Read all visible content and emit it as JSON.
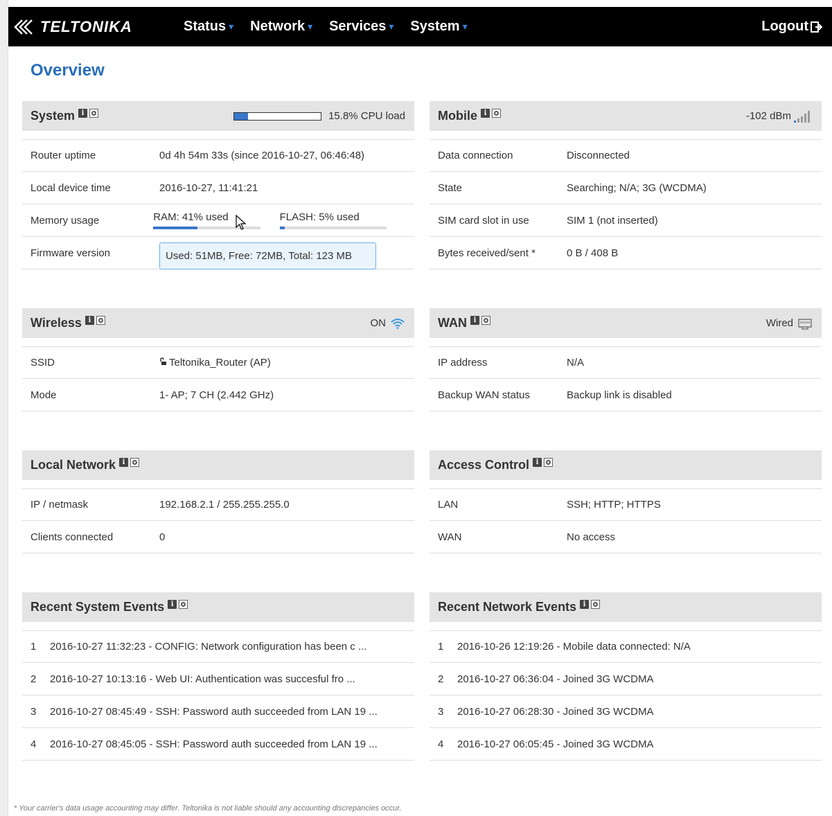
{
  "nav": {
    "brand": "TELTONIKA",
    "items": [
      {
        "label": "Status"
      },
      {
        "label": "Network"
      },
      {
        "label": "Services"
      },
      {
        "label": "System"
      }
    ],
    "logout": "Logout",
    "accent": "#3a7fd5"
  },
  "page": {
    "title": "Overview"
  },
  "system": {
    "title": "System",
    "cpu_text": "15.8% CPU load",
    "cpu_load": 0.158,
    "rows": {
      "uptime_label": "Router uptime",
      "uptime_value": "0d 4h 54m 33s (since 2016-10-27, 06:46:48)",
      "time_label": "Local device time",
      "time_value": "2016-10-27, 11:41:21",
      "memory_label": "Memory usage",
      "ram_text": "RAM: 41% used",
      "ram_used": 0.41,
      "flash_text": "FLASH: 5% used",
      "flash_used": 0.05,
      "firmware_label": "Firmware version"
    },
    "tooltip": "Used: 51MB, Free: 72MB, Total: 123 MB"
  },
  "mobile": {
    "title": "Mobile",
    "signal": "-102 dBm",
    "rows": {
      "data_label": "Data connection",
      "data_value": "Disconnected",
      "state_label": "State",
      "state_value": "Searching; N/A; 3G (WCDMA)",
      "sim_label": "SIM card slot in use",
      "sim_value": "SIM 1 (not inserted)",
      "bytes_label": "Bytes received/sent *",
      "bytes_value": "0 B / 408 B"
    }
  },
  "wireless": {
    "title": "Wireless",
    "status": "ON",
    "rows": {
      "ssid_label": "SSID",
      "ssid_value": "Teltonika_Router (AP)",
      "mode_label": "Mode",
      "mode_value": "1- AP; 7 CH (2.442 GHz)"
    }
  },
  "wan": {
    "title": "WAN",
    "status": "Wired",
    "rows": {
      "ip_label": "IP address",
      "ip_value": "N/A",
      "backup_label": "Backup WAN status",
      "backup_value": "Backup link is disabled"
    }
  },
  "local": {
    "title": "Local Network",
    "rows": {
      "ip_label": "IP / netmask",
      "ip_value": "192.168.2.1 / 255.255.255.0",
      "clients_label": "Clients connected",
      "clients_value": "0"
    }
  },
  "access": {
    "title": "Access Control",
    "rows": {
      "lan_label": "LAN",
      "lan_value": "SSH; HTTP; HTTPS",
      "wan_label": "WAN",
      "wan_value": "No access"
    }
  },
  "sys_events": {
    "title": "Recent System Events",
    "items": [
      {
        "num": "1",
        "text": "2016-10-27 11:32:23 - CONFIG: Network configuration has been c ..."
      },
      {
        "num": "2",
        "text": "2016-10-27 10:13:16 - Web UI: Authentication was succesful fro ..."
      },
      {
        "num": "3",
        "text": "2016-10-27 08:45:49 - SSH: Password auth succeeded from LAN 19 ..."
      },
      {
        "num": "4",
        "text": "2016-10-27 08:45:05 - SSH: Password auth succeeded from LAN 19 ..."
      }
    ]
  },
  "net_events": {
    "title": "Recent Network Events",
    "items": [
      {
        "num": "1",
        "text": "2016-10-26 12:19:26 - Mobile data connected: N/A"
      },
      {
        "num": "2",
        "text": "2016-10-27 06:36:04 - Joined 3G WCDMA"
      },
      {
        "num": "3",
        "text": "2016-10-27 06:28:30 - Joined 3G WCDMA"
      },
      {
        "num": "4",
        "text": "2016-10-27 06:05:45 - Joined 3G WCDMA"
      }
    ]
  },
  "footnote": "* Your carrier's data usage accounting may differ. Teltonika is not liable should any accounting discrepancies occur."
}
